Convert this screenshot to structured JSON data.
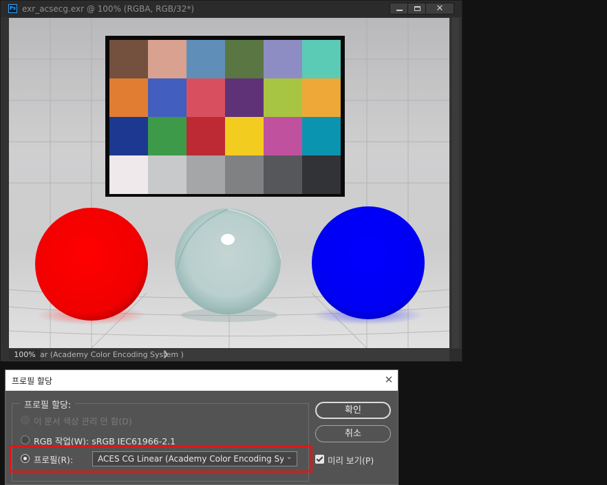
{
  "document_window": {
    "title": "exr_acsecg.exr @ 100% (RGBA, RGB/32*)",
    "app_icon_text": "Ps",
    "close_glyph": "✕",
    "zoom": "100%",
    "status_info": "ar (Academy Color Encoding System )",
    "status_arrow": "❯"
  },
  "scene": {
    "chart_rows": [
      [
        "#74503f",
        "#d9a290",
        "#5f8fb8",
        "#5a7743",
        "#8d8dc4",
        "#5bcbb6"
      ],
      [
        "#e07d33",
        "#425ebe",
        "#d8505f",
        "#5f3277",
        "#a8c443",
        "#eda838"
      ],
      [
        "#1c3890",
        "#3d9a48",
        "#bd2a33",
        "#f2cd1f",
        "#c0519f",
        "#0b94b0"
      ],
      [
        "#f0e9ec",
        "#c8c9ca",
        "#a5a6a8",
        "#808183",
        "#56575a",
        "#323336"
      ]
    ],
    "colors": {
      "red_sphere": "#ff0000",
      "blue_sphere": "#0000ff",
      "glass_sphere": "#a9cfcd"
    }
  },
  "dialog": {
    "title": "프로필 할당",
    "close_glyph": "✕",
    "group_label": "프로필 할당:",
    "options": [
      {
        "label": "이 문서 색상 관리 안 함(D)",
        "state": "disabled"
      },
      {
        "label": "RGB 작업(W): sRGB IEC61966-2.1",
        "state": "unselected"
      },
      {
        "label": "프로필(R):",
        "state": "selected"
      }
    ],
    "profile_value": "ACES CG Linear (Academy Color Encoding Syste...",
    "chevron": "⌄",
    "ok_label": "확인",
    "cancel_label": "취소",
    "preview_label": "미리 보기(P)",
    "preview_checked": true,
    "highlight_color": "#e51515"
  }
}
